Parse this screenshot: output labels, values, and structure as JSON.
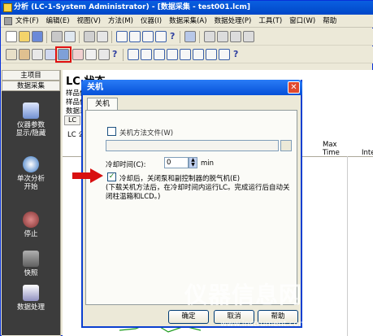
{
  "window": {
    "title": "分析 (LC-1-System Administrator) - [数据采集 - test001.lcm]"
  },
  "menu": [
    "文件(F)",
    "编辑(E)",
    "视图(V)",
    "方法(M)",
    "仪器(I)",
    "数据采集(A)",
    "数据处理(P)",
    "工具(T)",
    "窗口(W)",
    "帮助"
  ],
  "sidebar": {
    "tab_main": "主项目",
    "tab_acq": "数据采集",
    "items": [
      {
        "label": "仪器参数\n显示/隐藏",
        "icon": "instrument-params-icon"
      },
      {
        "label": "单次分析\n开始",
        "icon": "single-run-icon"
      },
      {
        "label": "停止",
        "icon": "stop-icon"
      },
      {
        "label": "快照",
        "icon": "snapshot-icon"
      },
      {
        "label": "数据处理",
        "icon": "data-processing-icon"
      }
    ]
  },
  "main": {
    "title": "LC 状态",
    "row1": "样品信",
    "row2": "样品信",
    "row3": "数据采",
    "tab_lc": "LC",
    "lc_label": "LC 公",
    "col_time": "Time",
    "col_max": "Max",
    "col_inte": "Inte"
  },
  "dialog": {
    "title": "关机",
    "tab": "关机",
    "shutdown_file_label": "关机方法文件(W)",
    "cooling_label": "冷却时间(C):",
    "cooling_value": "0",
    "cooling_unit": "min",
    "checkbox_label": "冷却后，关闭泵和副控制器的脱气机(E)",
    "checkbox_checked": true,
    "note": "(下载关机方法后，在冷却时间内运行LC。完成运行后自动关闭柱温箱和LCD。)",
    "ok": "确定",
    "cancel": "取消",
    "help": "帮助"
  },
  "watermark": {
    "text": "仪器信息网",
    "url": "www.instrument.com.cn"
  }
}
